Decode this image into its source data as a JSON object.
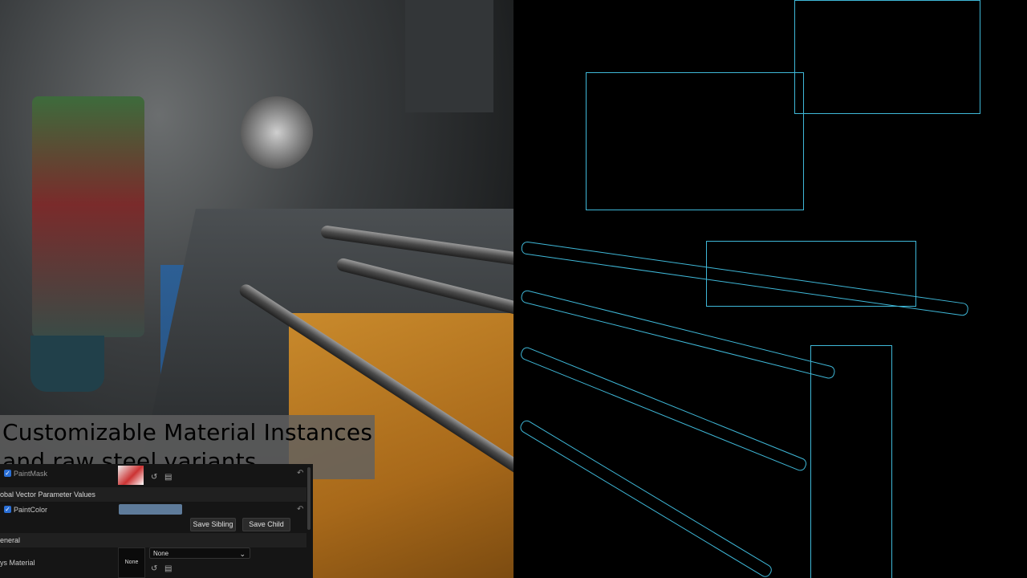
{
  "caption": {
    "line1": "Customizable Material Instances",
    "line2": "and raw steel variants"
  },
  "panel": {
    "paint_mask": {
      "label": "PaintMask",
      "checked": true
    },
    "global_vector_header": "obal Vector Parameter Values",
    "paint_color": {
      "label": "PaintColor",
      "checked": true,
      "color": "#5e7b9a"
    },
    "buttons": {
      "save_sibling": "Save Sibling",
      "save_child": "Save Child"
    },
    "general_header": "eneral",
    "material": {
      "label": "ys Material",
      "thumb_text": "None",
      "dropdown_value": "None"
    },
    "icons": {
      "reset": "reset-arrow-icon",
      "use_selected": "use-selected-icon",
      "browse": "browse-folder-icon",
      "chevron": "chevron-down-icon"
    }
  },
  "colors": {
    "wireframe": "#3fb8d8",
    "caption_bg": "#606060",
    "panel_bg": "#151515"
  }
}
